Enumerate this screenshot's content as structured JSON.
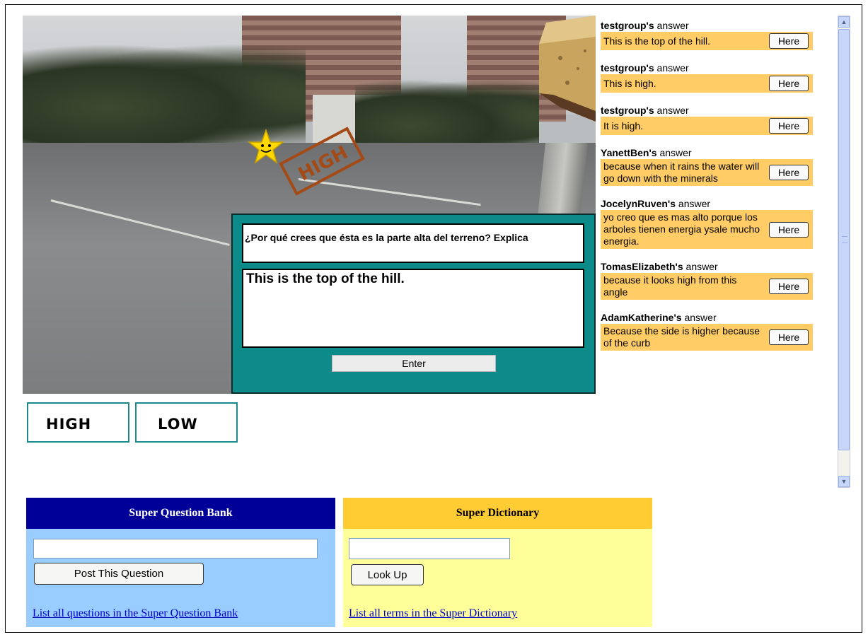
{
  "question": {
    "prompt": "¿Por qué crees que ésta es la parte alta del terreno? Explica",
    "answer_value": "This is the top of the hill.",
    "enter_label": "Enter"
  },
  "scene": {
    "sign_text": "HIGH"
  },
  "choices": {
    "high_label": "HIGH",
    "low_label": "LOW"
  },
  "answers": {
    "suffix": " answer",
    "here_label": "Here",
    "items": [
      {
        "user": "testgroup's",
        "text": "This is the top of the hill."
      },
      {
        "user": "testgroup's",
        "text": "This is high."
      },
      {
        "user": "testgroup's",
        "text": "It is high."
      },
      {
        "user": "YanettBen's",
        "text": "because when it rains the water will go down with the minerals"
      },
      {
        "user": "JocelynRuven's",
        "text": "yo creo que es mas alto porque los arboles tienen energia ysale mucho energia."
      },
      {
        "user": "TomasElizabeth's",
        "text": "because it looks high from this angle"
      },
      {
        "user": "AdamKatherine's",
        "text": "Because the side is higher because of the curb"
      }
    ]
  },
  "question_bank": {
    "title": "Super Question Bank",
    "input_value": "",
    "post_label": "Post This Question",
    "link_text": "List all questions in the Super Question Bank"
  },
  "dictionary": {
    "title": "Super Dictionary",
    "input_value": "",
    "lookup_label": "Look Up",
    "link_text": "List all terms in the Super Dictionary"
  },
  "colors": {
    "panel_teal": "#0d8a8a",
    "answer_bg": "#ffcc66",
    "qbank_header": "#000099",
    "qbank_bg": "#99ccff",
    "dict_header": "#ffcc33",
    "dict_bg": "#ffff99"
  }
}
